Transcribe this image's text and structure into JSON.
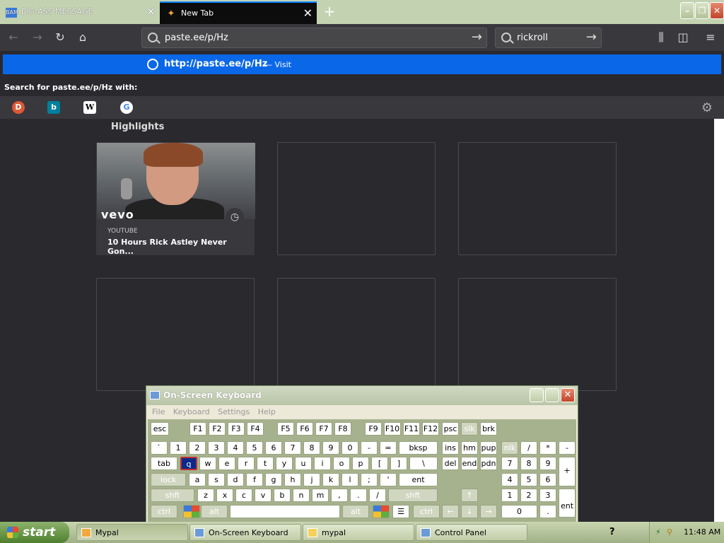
{
  "browser": {
    "tabs": [
      {
        "favicon": "BAM",
        "title": "BIG-ASS MESSAGE"
      },
      {
        "favicon": "firefox-icon",
        "title": "New Tab"
      }
    ],
    "url_value": "paste.ee/p/Hz",
    "search_value": "rickroll",
    "suggestion_url": "http://paste.ee/p/Hz",
    "suggestion_visit": "— Visit",
    "search_with": "Search for paste.ee/p/Hz with:",
    "highlights_title": "Highlights",
    "card": {
      "source": "YOUTUBE",
      "title": "10 Hours Rick Astley Never Gon...",
      "thumb_text": "vevo"
    }
  },
  "osk": {
    "title": "On-Screen Keyboard",
    "menu": [
      "File",
      "Keyboard",
      "Settings",
      "Help"
    ],
    "rows": [
      [
        "esc",
        "F1",
        "F2",
        "F3",
        "F4",
        "F5",
        "F6",
        "F7",
        "F8",
        "F9",
        "F10",
        "F11",
        "F12",
        "psc",
        "slk",
        "brk"
      ],
      [
        "`",
        "1",
        "2",
        "3",
        "4",
        "5",
        "6",
        "7",
        "8",
        "9",
        "0",
        "-",
        "=",
        "bksp",
        "ins",
        "hm",
        "pup",
        "nlk",
        "/",
        "*",
        "-"
      ],
      [
        "tab",
        "q",
        "w",
        "e",
        "r",
        "t",
        "y",
        "u",
        "i",
        "o",
        "p",
        "[",
        "]",
        "\\",
        "del",
        "end",
        "pdn",
        "7",
        "8",
        "9",
        "+"
      ],
      [
        "lock",
        "a",
        "s",
        "d",
        "f",
        "g",
        "h",
        "j",
        "k",
        "l",
        ";",
        "'",
        "ent",
        "4",
        "5",
        "6"
      ],
      [
        "shft",
        "z",
        "x",
        "c",
        "v",
        "b",
        "n",
        "m",
        ",",
        ".",
        "/",
        "shft",
        "↑",
        "1",
        "2",
        "3",
        "ent"
      ],
      [
        "ctrl",
        "alt",
        "alt",
        "ctrl",
        "←",
        "↓",
        "→",
        "0",
        "."
      ]
    ]
  },
  "taskbar": {
    "start_label": "start",
    "tasks": [
      "Mypal",
      "On-Screen Keyboard",
      "mypal",
      "Control Panel"
    ],
    "clock": "11:48 AM"
  }
}
